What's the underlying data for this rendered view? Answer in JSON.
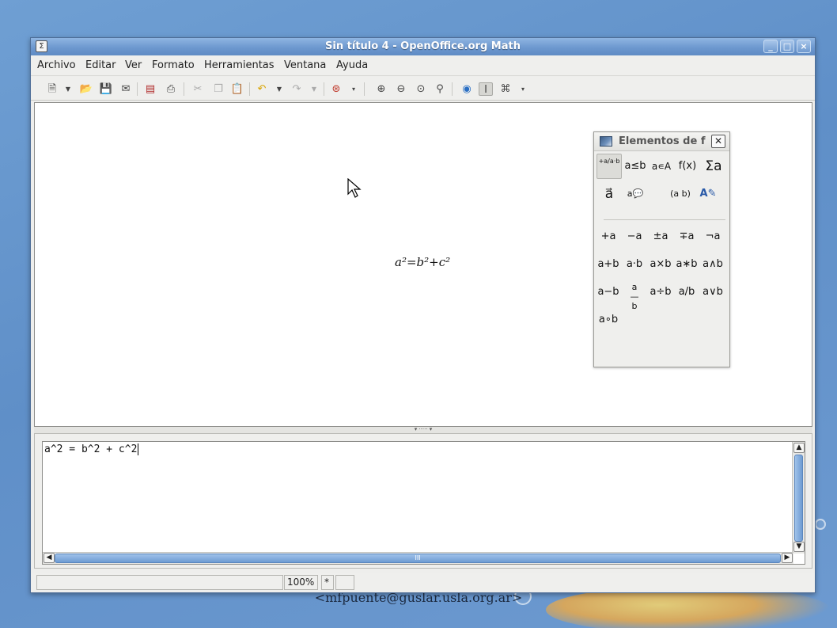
{
  "window": {
    "title": "Sin título 4 - OpenOffice.org Math",
    "app_icon": "Σ",
    "controls": {
      "minimize": "_",
      "maximize": "□",
      "close": "×"
    }
  },
  "menubar": {
    "items": [
      {
        "label": "Archivo"
      },
      {
        "label": "Editar"
      },
      {
        "label": "Ver"
      },
      {
        "label": "Formato"
      },
      {
        "label": "Herramientas"
      },
      {
        "label": "Ventana"
      },
      {
        "label": "Ayuda"
      }
    ]
  },
  "toolbar": {
    "icons": [
      "new-document-icon",
      "dropdown-icon",
      "open-icon",
      "save-icon",
      "email-icon",
      "export-pdf-icon",
      "print-icon",
      "cut-icon",
      "copy-icon",
      "paste-icon",
      "undo-icon",
      "redo-icon",
      "help-icon",
      "zoom-in-icon",
      "zoom-out-icon",
      "zoom-100-icon",
      "show-all-icon",
      "update-icon",
      "formula-cursor-icon",
      "symbols-icon"
    ]
  },
  "formula_view": {
    "rendered_formula": "a²=b²+c²"
  },
  "elements_panel": {
    "title": "Elementos de f",
    "close": "✕",
    "categories": [
      [
        "+a/a·b",
        "a≤b",
        "a∊A",
        "f(x)",
        "Σa"
      ],
      [
        "a⃗",
        "a💬",
        "",
        "(a b)",
        "A✎"
      ]
    ],
    "operators": [
      [
        "+a",
        "−a",
        "±a",
        "∓a",
        "¬a"
      ],
      [
        "a+b",
        "a·b",
        "a×b",
        "a∗b",
        "a∧b"
      ],
      [
        "a−b",
        "a/b",
        "a÷b",
        "a/b",
        "a∨b"
      ],
      [
        "a∘b"
      ]
    ]
  },
  "command": {
    "text": "a^2 = b^2 + c^2"
  },
  "statusbar": {
    "zoom": "100%",
    "modified": "*"
  },
  "desktop": {
    "footer_email": "<mfpuente@guslar.usla.org.ar>"
  }
}
